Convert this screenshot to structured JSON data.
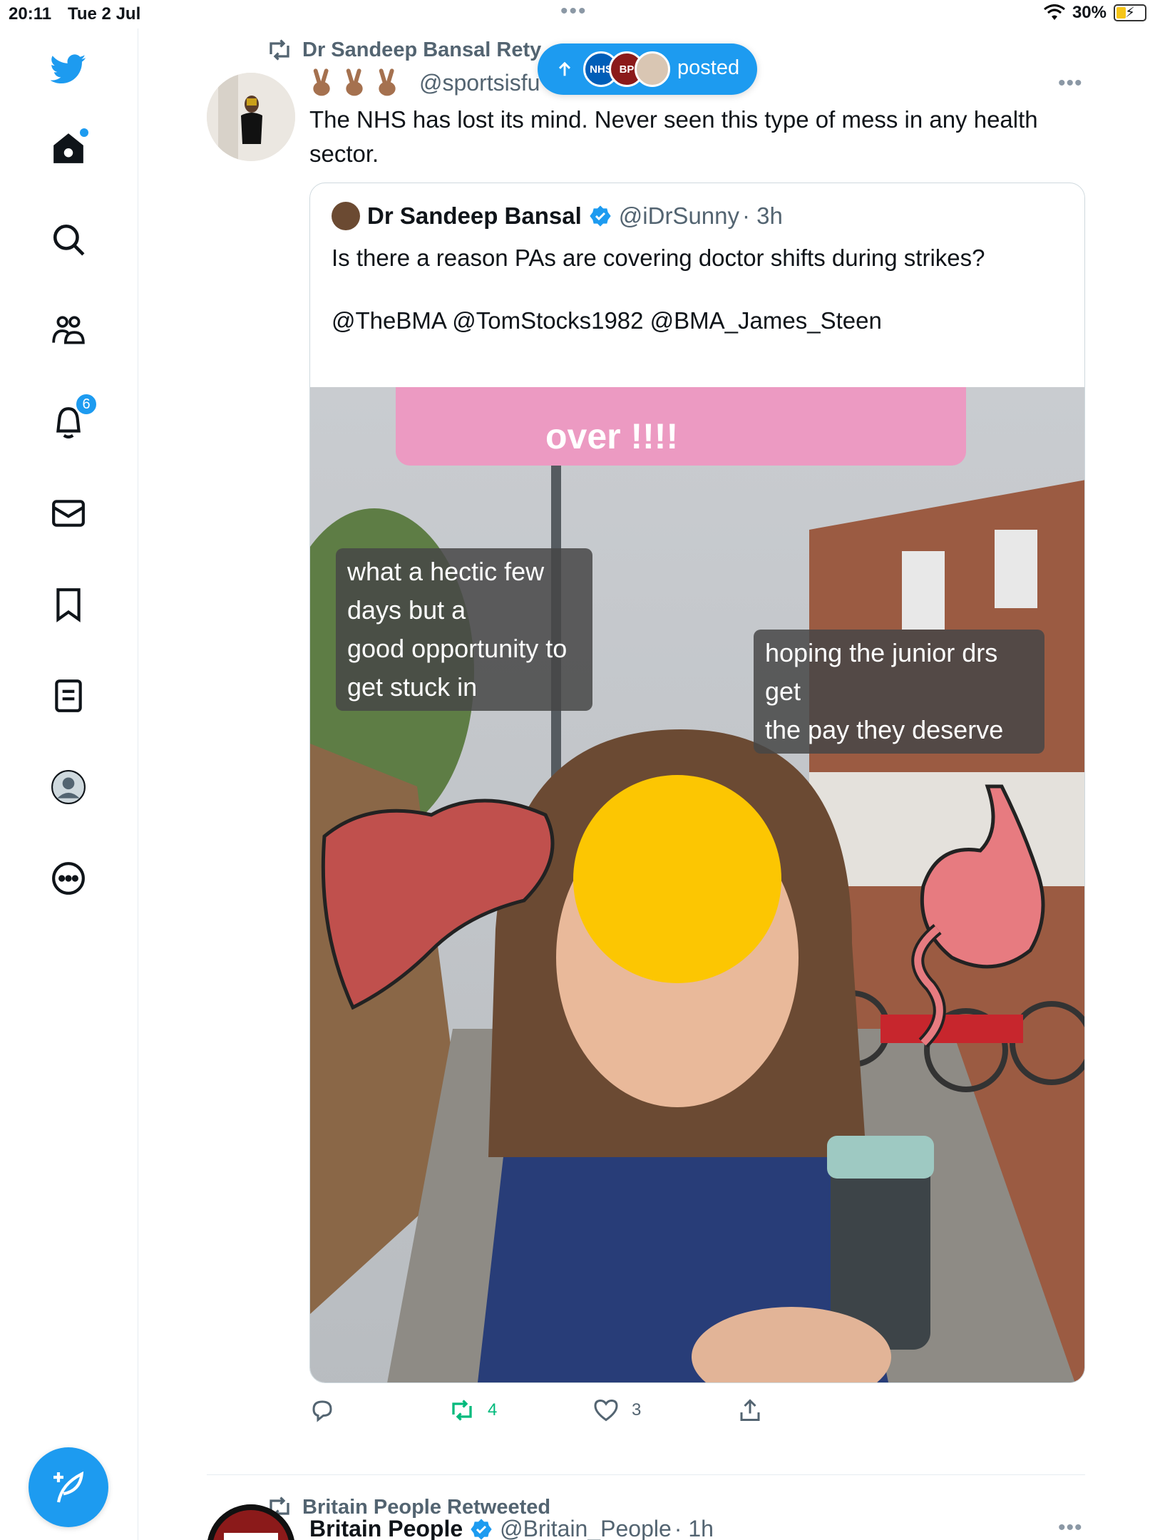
{
  "status_bar": {
    "time": "20:11",
    "date": "Tue 2 Jul",
    "battery_level": "30%",
    "battery_fraction": 0.3
  },
  "sidebar": {
    "items": [
      {
        "name": "twitter-logo",
        "icon": "twitter-bird-icon"
      },
      {
        "name": "home",
        "icon": "home-icon"
      },
      {
        "name": "explore",
        "icon": "search-icon"
      },
      {
        "name": "communities",
        "icon": "communities-icon"
      },
      {
        "name": "notifications",
        "icon": "bell-icon",
        "badge": "6"
      },
      {
        "name": "messages",
        "icon": "mail-icon"
      },
      {
        "name": "bookmarks",
        "icon": "bookmark-icon"
      },
      {
        "name": "lists",
        "icon": "list-icon"
      },
      {
        "name": "profile",
        "icon": "profile-icon"
      },
      {
        "name": "more",
        "icon": "more-circle-icon"
      }
    ],
    "compose_icon": "compose-feather-icon"
  },
  "posted_pill": {
    "label": "posted",
    "avatar_1_text": "NHS",
    "avatar_2_text": "BP"
  },
  "tweet_1": {
    "retweeted_by": "Dr Sandeep Bansal Rety",
    "handle": "@sportsisfu",
    "text": "The NHS has lost its mind. Never seen this type of mess in any health sector.",
    "quote": {
      "author": "Dr Sandeep Bansal",
      "handle": "@iDrSunny",
      "time": "· 3h",
      "text": "Is there a reason PAs are covering doctor shifts during strikes?",
      "mentions": "@TheBMA @TomStocks1982 @BMA_James_Steen",
      "media": {
        "sticker_top": "over !!!!",
        "sticker_left_line1": "what a hectic few days",
        "sticker_left_line1b": " but a",
        "sticker_left_line2": "good opportunity to get stuck in",
        "sticker_right_line1": "hoping the junior drs get",
        "sticker_right_line2": "the pay they deserve"
      }
    },
    "actions": {
      "reply_count": "",
      "retweet_count": "4",
      "like_count": "3"
    }
  },
  "tweet_2": {
    "retweeted_by": "Britain People Retweeted",
    "author": "Britain People",
    "handle": "@Britain_People",
    "time": "· 1h"
  },
  "colors": {
    "accent": "#1d9bf0",
    "retweet_green": "#00ba7c",
    "secondary_text": "#536471"
  }
}
